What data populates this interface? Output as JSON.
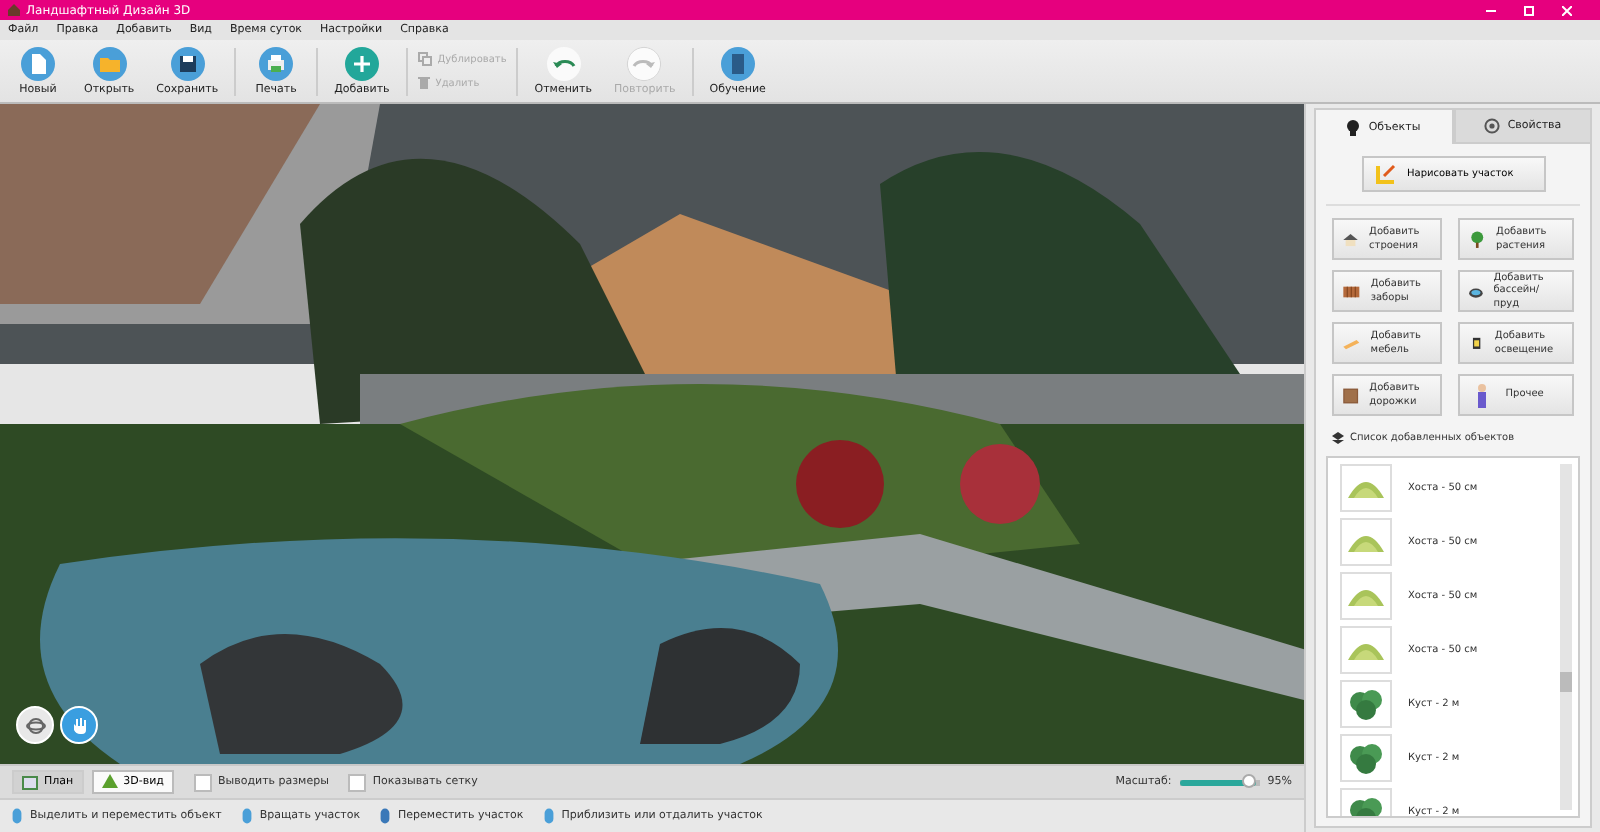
{
  "window": {
    "title": "Ландшафтный Дизайн 3D"
  },
  "menu": [
    "Файл",
    "Правка",
    "Добавить",
    "Вид",
    "Время суток",
    "Настройки",
    "Справка"
  ],
  "toolbar": [
    {
      "kind": "new",
      "label": "Новый",
      "disabled": false
    },
    {
      "kind": "open",
      "label": "Открыть",
      "disabled": false
    },
    {
      "kind": "save",
      "label": "Сохранить",
      "disabled": false
    },
    {
      "kind": "sep"
    },
    {
      "kind": "print",
      "label": "Печать",
      "disabled": false
    },
    {
      "kind": "sep"
    },
    {
      "kind": "add",
      "label": "Добавить",
      "disabled": false
    },
    {
      "kind": "sep"
    },
    {
      "kind": "small",
      "items": [
        {
          "kind": "duplicate",
          "label": "Дублировать",
          "disabled": true
        },
        {
          "kind": "delete",
          "label": "Удалить",
          "disabled": true
        }
      ]
    },
    {
      "kind": "sep"
    },
    {
      "kind": "undo",
      "label": "Отменить",
      "disabled": false
    },
    {
      "kind": "redo",
      "label": "Повторить",
      "disabled": true
    },
    {
      "kind": "sep"
    },
    {
      "kind": "help",
      "label": "Обучение",
      "disabled": false
    }
  ],
  "view_modes": [
    {
      "kind": "plan",
      "label": "План",
      "selected": false
    },
    {
      "kind": "threed",
      "label": "3D-вид",
      "selected": true
    }
  ],
  "options": [
    {
      "label": "Выводить размеры",
      "checked": false
    },
    {
      "label": "Показывать сетку",
      "checked": false
    }
  ],
  "zoom": {
    "label": "Масштаб:",
    "level": 0.95,
    "reading": "95%"
  },
  "status_bar": [
    {
      "kind": "select",
      "label": "Выделить и переместить объект"
    },
    {
      "kind": "rotate",
      "label": "Вращать участок"
    },
    {
      "kind": "move",
      "label": "Переместить участок"
    },
    {
      "kind": "zoom",
      "label": "Приблизить или отдалить участок"
    }
  ],
  "panel": {
    "tabs": [
      {
        "kind": "objects",
        "label": "Объекты",
        "selected": true
      },
      {
        "kind": "props",
        "label": "Свойства",
        "selected": false
      }
    ],
    "draw_button": "Нарисовать участок",
    "add_buttons": [
      {
        "kind": "building",
        "label": "Добавить строения"
      },
      {
        "kind": "plant",
        "label": "Добавить растения"
      },
      {
        "kind": "fence",
        "label": "Добавить заборы"
      },
      {
        "kind": "pool",
        "label": "Добавить бассейн/пруд"
      },
      {
        "kind": "furniture",
        "label": "Добавить мебель"
      },
      {
        "kind": "light",
        "label": "Добавить освещение"
      },
      {
        "kind": "path",
        "label": "Добавить дорожки"
      },
      {
        "kind": "other",
        "label": "Прочее"
      }
    ],
    "list_title": "Список добавленных объектов",
    "objects": [
      {
        "kind": "hosta",
        "name": "Хоста - 50 см"
      },
      {
        "kind": "hosta",
        "name": "Хоста - 50 см"
      },
      {
        "kind": "hosta",
        "name": "Хоста - 50 см"
      },
      {
        "kind": "hosta",
        "name": "Хоста - 50 см"
      },
      {
        "kind": "bush",
        "name": "Куст - 2 м"
      },
      {
        "kind": "bush",
        "name": "Куст - 2 м"
      },
      {
        "kind": "bush",
        "name": "Куст - 2 м"
      }
    ]
  }
}
